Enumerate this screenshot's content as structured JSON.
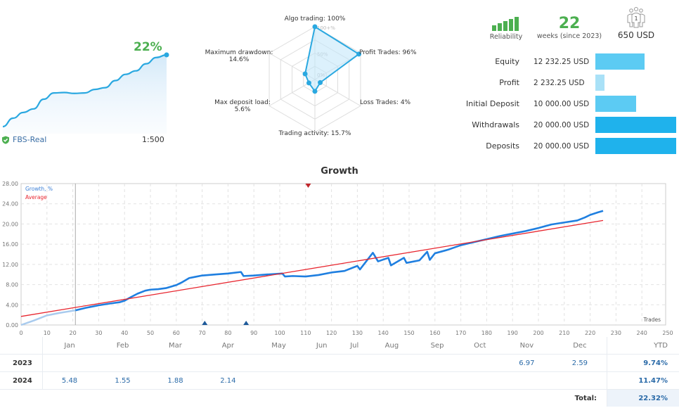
{
  "summary": {
    "growth_pct_label": "22%",
    "broker": "FBS-Real",
    "leverage": "1:500",
    "mini_curve": [
      0,
      1.9,
      3.2,
      4.0,
      6.2,
      7.6,
      7.7,
      7.5,
      7.6,
      8.4,
      8.8,
      10.4,
      11.8,
      12.6,
      14.2,
      15.6,
      16.2
    ]
  },
  "radar": {
    "axes": [
      {
        "label": "Algo trading: 100%",
        "value": 100
      },
      {
        "label": "Profit Trades: 96%",
        "value": 96
      },
      {
        "label": "Loss Trades: 4%",
        "value": 4
      },
      {
        "label": "Trading activity: 15.7%",
        "value": 15.7
      },
      {
        "label": "Max deposit load:",
        "label2": "5.6%",
        "value": 5.6
      },
      {
        "label": "Maximum drawdown:",
        "label2": "14.6%",
        "value": 14.6
      }
    ],
    "scale_labels": [
      "100+%",
      "50%",
      "0%"
    ]
  },
  "stats": {
    "reliability_label": "Reliability",
    "weeks_value": "22",
    "weeks_label": "weeks (since 2023)",
    "subscribers_count": "1",
    "price": "650 USD",
    "rows": [
      {
        "label": "Equity",
        "value": "12 232.25 USD",
        "amount": 12232.25
      },
      {
        "label": "Profit",
        "value": "2 232.25 USD",
        "amount": 2232.25
      },
      {
        "label": "Initial Deposit",
        "value": "10 000.00 USD",
        "amount": 10000
      },
      {
        "label": "Withdrawals",
        "value": "20 000.00 USD",
        "amount": 20000
      },
      {
        "label": "Deposits",
        "value": "20 000.00 USD",
        "amount": 20000
      }
    ],
    "colors": {
      "equity": "#5ccbf3",
      "profit": "#a9e1f7",
      "initial": "#5ccbf3",
      "withdrawals": "#1fb2ec",
      "deposits": "#1fb2ec"
    }
  },
  "chart_data": {
    "type": "line",
    "title": "Growth",
    "xlabel": "Trades",
    "ylabel": "",
    "xlim": [
      0,
      250
    ],
    "ylim": [
      0,
      28
    ],
    "xticks": [
      0,
      10,
      20,
      30,
      40,
      50,
      60,
      70,
      80,
      90,
      100,
      110,
      120,
      130,
      140,
      150,
      160,
      170,
      180,
      190,
      200,
      210,
      220,
      230,
      240,
      250
    ],
    "yticks": [
      "0.00",
      "4.00",
      "8.00",
      "12.00",
      "16.00",
      "20.00",
      "24.00",
      "28.00"
    ],
    "grid": true,
    "legend": [
      "Growth, %",
      "Average"
    ],
    "legend_position": "top-left",
    "month_labels": [
      "Jan",
      "Feb",
      "Mar",
      "Apr",
      "May",
      "Jun",
      "Jul",
      "Aug",
      "Sep",
      "Oct",
      "Nov",
      "Dec"
    ],
    "month_label_x": [
      20.5,
      38,
      57,
      75,
      95,
      113,
      131,
      149,
      168,
      186,
      205,
      223
    ],
    "year_divider_x": 21,
    "series": [
      {
        "name": "Growth, %",
        "color": "#1f7fe0",
        "pre_x": [
          0,
          5,
          10,
          15,
          21
        ],
        "pre_y": [
          0,
          0.9,
          1.9,
          2.4,
          2.9
        ],
        "x": [
          21,
          25,
          30,
          35,
          38,
          40,
          42,
          45,
          48,
          50,
          53,
          56,
          60,
          62,
          65,
          67,
          70,
          75,
          80,
          85,
          86,
          90,
          95,
          101,
          102,
          105,
          110,
          115,
          120,
          125,
          130,
          131,
          136,
          138,
          142,
          143,
          148,
          149,
          154,
          157,
          158,
          160,
          165,
          170,
          175,
          180,
          185,
          190,
          195,
          200,
          205,
          210,
          215,
          218,
          220,
          223,
          225
        ],
        "y": [
          2.9,
          3.4,
          3.9,
          4.3,
          4.5,
          4.8,
          5.4,
          6.2,
          6.8,
          7.0,
          7.1,
          7.3,
          7.9,
          8.4,
          9.3,
          9.5,
          9.8,
          10.0,
          10.2,
          10.5,
          9.7,
          9.8,
          10.0,
          10.2,
          9.6,
          9.7,
          9.6,
          9.9,
          10.4,
          10.7,
          11.7,
          11.0,
          14.3,
          12.6,
          13.3,
          11.8,
          13.3,
          12.3,
          12.8,
          14.5,
          12.9,
          14.2,
          14.9,
          15.8,
          16.4,
          17.0,
          17.6,
          18.1,
          18.6,
          19.2,
          19.9,
          20.3,
          20.7,
          21.3,
          21.8,
          22.3,
          22.6
        ]
      },
      {
        "name": "Average",
        "color": "#e8262f",
        "x": [
          0,
          225
        ],
        "y": [
          1.7,
          20.7
        ]
      }
    ],
    "markers": [
      {
        "type": "deposit",
        "x": 71,
        "color": "#1e5a9a"
      },
      {
        "type": "deposit",
        "x": 87,
        "color": "#1e5a9a"
      },
      {
        "type": "withdrawal",
        "x": 111,
        "color": "#c0262b"
      }
    ]
  },
  "monthly_table": {
    "headers": [
      "Jan",
      "Feb",
      "Mar",
      "Apr",
      "May",
      "Jun",
      "Jul",
      "Aug",
      "Sep",
      "Oct",
      "Nov",
      "Dec"
    ],
    "ytd_header": "YTD",
    "rows": [
      {
        "year": "2023",
        "values": [
          "",
          "",
          "",
          "",
          "",
          "",
          "",
          "",
          "",
          "",
          "6.97",
          "2.59"
        ],
        "ytd": "9.74%"
      },
      {
        "year": "2024",
        "values": [
          "5.48",
          "1.55",
          "1.88",
          "2.14",
          "",
          "",
          "",
          "",
          "",
          "",
          "",
          ""
        ],
        "ytd": "11.47%"
      }
    ],
    "total_label": "Total:",
    "total_value": "22.32%"
  }
}
